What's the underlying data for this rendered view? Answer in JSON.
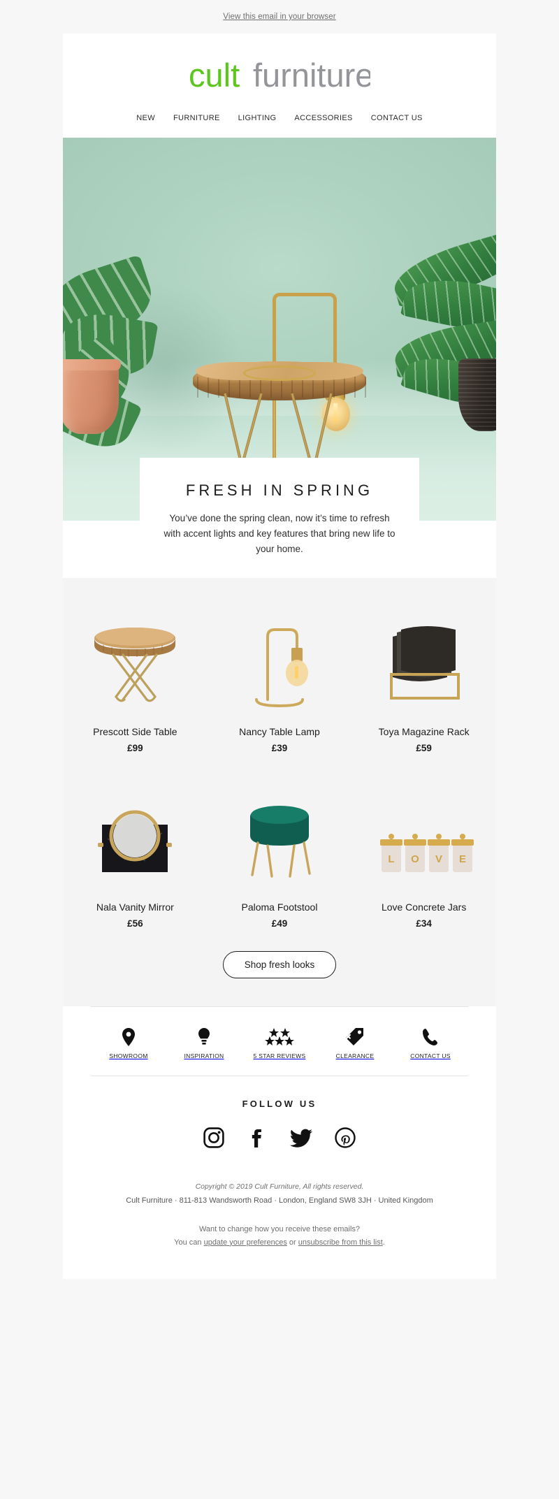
{
  "preheader": {
    "view_in_browser": "View this email in your browser"
  },
  "brand": {
    "name_part1": "cult",
    "name_part2": "furniture",
    "green": "#5cc61e",
    "grey": "#939598"
  },
  "nav": {
    "items": [
      {
        "label": "NEW"
      },
      {
        "label": "FURNITURE"
      },
      {
        "label": "LIGHTING"
      },
      {
        "label": "ACCESSORIES"
      },
      {
        "label": "CONTACT US"
      }
    ]
  },
  "hero": {
    "alt": "Brass table lamp on a wood slab side table with tropical plants on a mint green background",
    "background_color": "#aed2c0",
    "floor_color": "#dcefe5"
  },
  "headline_card": {
    "title": "FRESH IN SPRING",
    "body": "You’ve done the spring clean, now it’s time to refresh with accent lights and key features that bring new life to your home."
  },
  "products": {
    "rows": [
      [
        {
          "name": "Prescott Side Table",
          "price": "£99",
          "image": "wood-slab-side-table"
        },
        {
          "name": "Nancy Table Lamp",
          "price": "£39",
          "image": "brass-table-lamp"
        },
        {
          "name": "Toya Magazine Rack",
          "price": "£59",
          "image": "leather-magazine-rack"
        }
      ],
      [
        {
          "name": "Nala Vanity Mirror",
          "price": "£56",
          "image": "marble-vanity-mirror"
        },
        {
          "name": "Paloma Footstool",
          "price": "£49",
          "image": "green-velvet-footstool"
        },
        {
          "name": "Love Concrete Jars",
          "price": "£34",
          "image": "love-concrete-jars"
        }
      ]
    ]
  },
  "cta": {
    "label": "Shop fresh looks"
  },
  "footer": {
    "services": [
      {
        "label": "SHOWROOM",
        "icon": "location-pin-icon"
      },
      {
        "label": "INSPIRATION",
        "icon": "lightbulb-icon"
      },
      {
        "label": "5 STAR REVIEWS",
        "icon": "five-stars-icon"
      },
      {
        "label": "CLEARANCE",
        "icon": "price-tag-icon"
      },
      {
        "label": "CONTACT US",
        "icon": "phone-icon"
      }
    ],
    "follow_title": "FOLLOW US",
    "socials": [
      {
        "name": "instagram-icon"
      },
      {
        "name": "facebook-icon"
      },
      {
        "name": "twitter-icon"
      },
      {
        "name": "pinterest-icon"
      }
    ],
    "copyright": "Copyright © 2019 Cult Furniture, All rights reserved.",
    "address": "Cult Furniture · 811-813 Wandsworth Road · London, England SW8 3JH · United Kingdom",
    "prefs_question": "Want to change how you receive these emails?",
    "prefs_prefix": "You can ",
    "prefs_link": "update your preferences",
    "prefs_middle": " or ",
    "unsub_link": "unsubscribe from this list",
    "prefs_suffix": "."
  }
}
